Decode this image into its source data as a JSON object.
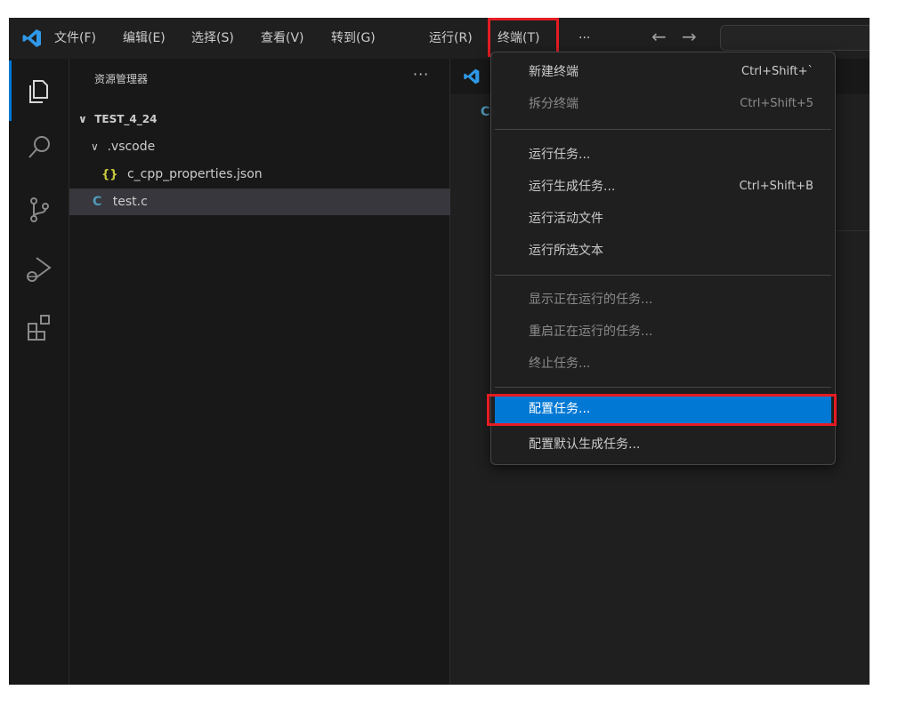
{
  "menubar": {
    "items": [
      "文件(F)",
      "编辑(E)",
      "选择(S)",
      "查看(V)",
      "转到(G)",
      "运行(R)",
      "终端(T)",
      "···"
    ],
    "back": "←",
    "forward": "→"
  },
  "sidebar": {
    "title": "资源管理器",
    "more": "···",
    "tree": [
      {
        "twisty": "∨",
        "label": "TEST_4_24"
      },
      {
        "twisty": "∨",
        "label": ".vscode"
      },
      {
        "icon": "{}",
        "label": "c_cpp_properties.json"
      },
      {
        "icon": "C",
        "label": "test.c"
      }
    ]
  },
  "editor": {
    "breadcrumb_icon": "C"
  },
  "terminal_menu": {
    "items": [
      {
        "label": "新建终端",
        "shortcut": "Ctrl+Shift+`"
      },
      {
        "label": "拆分终端",
        "shortcut": "Ctrl+Shift+5"
      },
      {
        "label": "运行任务..."
      },
      {
        "label": "运行生成任务...",
        "shortcut": "Ctrl+Shift+B"
      },
      {
        "label": "运行活动文件"
      },
      {
        "label": "运行所选文本"
      },
      {
        "label": "显示正在运行的任务..."
      },
      {
        "label": "重启正在运行的任务..."
      },
      {
        "label": "终止任务..."
      },
      {
        "label": "配置任务..."
      },
      {
        "label": "配置默认生成任务..."
      }
    ]
  },
  "colors": {
    "accent": "#0078d4",
    "highlight_box": "#e51c23",
    "background": "#181818"
  },
  "icons": [
    "vscode-logo-icon",
    "explorer-icon",
    "search-icon",
    "source-control-icon",
    "run-debug-icon",
    "extensions-icon"
  ]
}
